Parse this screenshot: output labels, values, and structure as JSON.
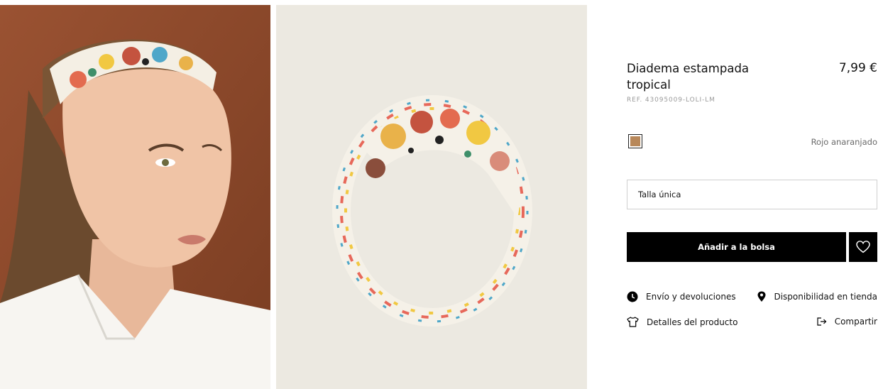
{
  "product": {
    "title": "Diadema estampada tropical",
    "price": "7,99 €",
    "ref": "REF. 43095009-LOLI-LM"
  },
  "color": {
    "swatch_hex": "#b8885a",
    "name": "Rojo anaranjado"
  },
  "size": {
    "selected": "Talla única"
  },
  "actions": {
    "add_to_bag": "Añadir a la bolsa",
    "favorite_icon": "heart-icon"
  },
  "links": [
    {
      "label": "Envío y devoluciones",
      "icon": "clock-icon"
    },
    {
      "label": "Disponibilidad en tienda",
      "icon": "location-pin-icon"
    },
    {
      "label": "Detalles del producto",
      "icon": "tshirt-icon"
    },
    {
      "label": "Compartir",
      "icon": "share-icon"
    }
  ]
}
